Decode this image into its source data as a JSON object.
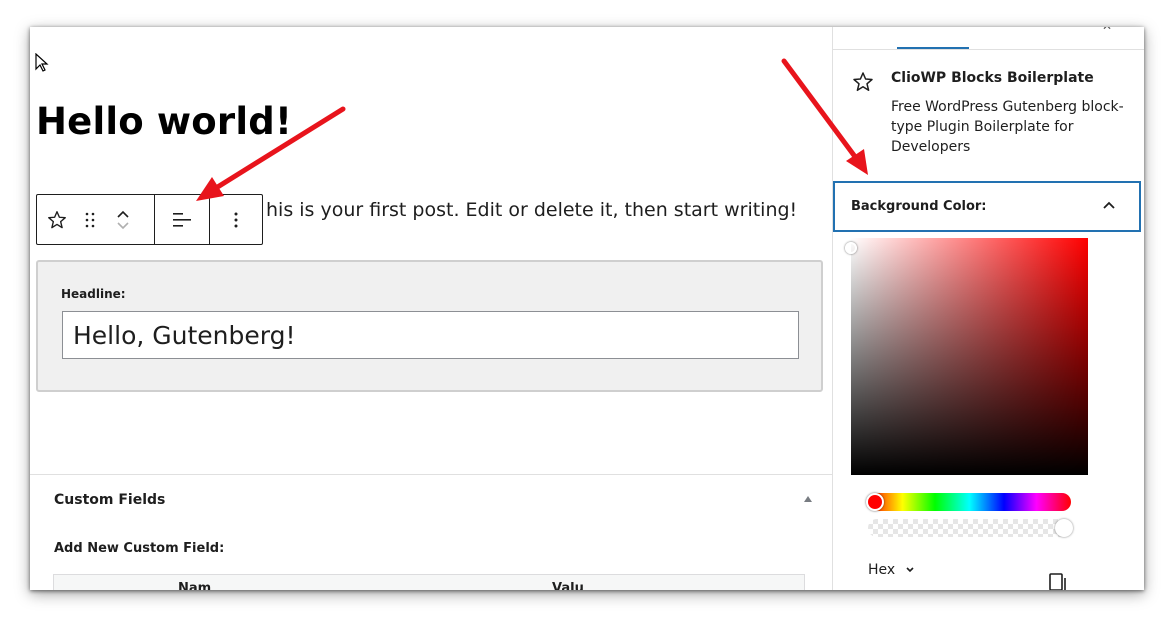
{
  "editor": {
    "post_title": "Hello world!",
    "paragraph": "his is your first post. Edit or delete it, then start writing!",
    "toolbar": {
      "icons": [
        "star-icon",
        "drag-handle-icon",
        "chevron-up-icon",
        "chevron-down-icon",
        "align-left-icon",
        "more-options-icon"
      ]
    },
    "headline_block": {
      "label": "Headline:",
      "value": "Hello, Gutenberg!"
    }
  },
  "meta_boxes": {
    "custom_fields_title": "Custom Fields",
    "add_new_label": "Add New Custom Field:",
    "table_headers": [
      "Nam",
      "Valu"
    ]
  },
  "sidebar": {
    "block_card": {
      "title": "ClioWP Blocks Boilerplate",
      "description": "Free WordPress Gutenberg block-type Plugin Boilerplate for Developers"
    },
    "panel": {
      "title": "Background Color:",
      "expanded": true
    },
    "color_picker": {
      "hue_color": "#ff0000",
      "format": "Hex"
    }
  },
  "colors": {
    "accent": "#2271b1",
    "annotation_arrow": "#e8141c"
  }
}
